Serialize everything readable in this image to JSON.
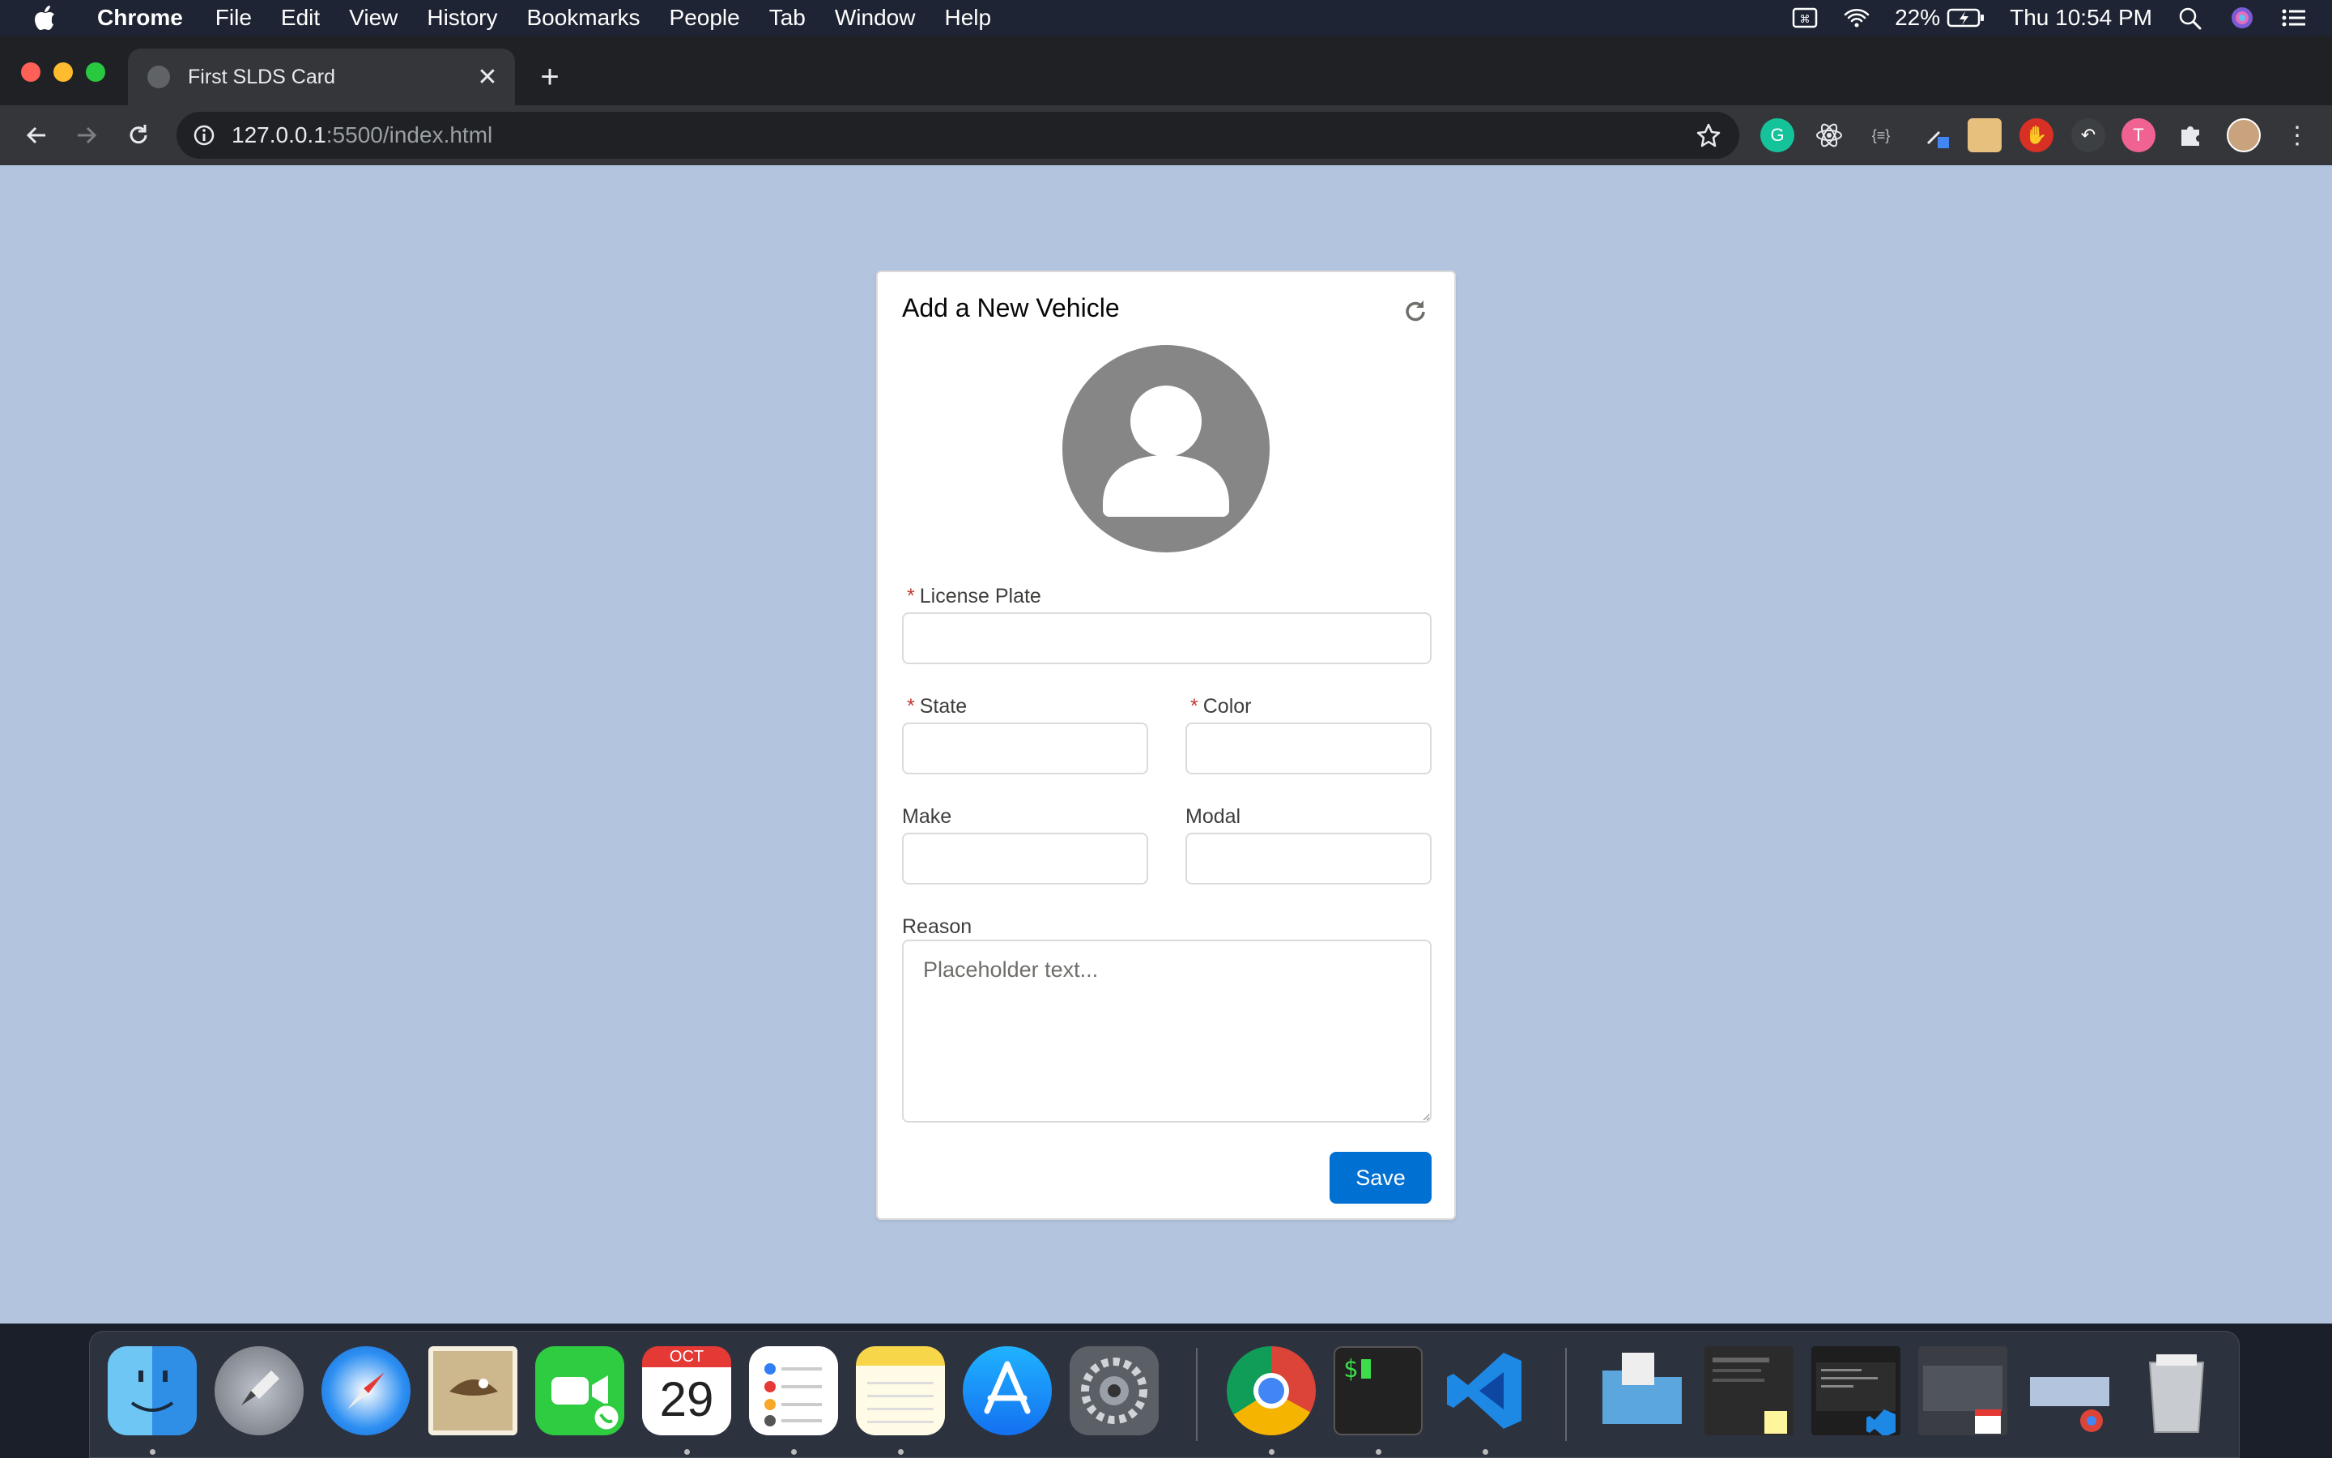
{
  "menubar": {
    "app": "Chrome",
    "items": [
      "File",
      "Edit",
      "View",
      "History",
      "Bookmarks",
      "People",
      "Tab",
      "Window",
      "Help"
    ],
    "battery": "22%",
    "clock": "Thu 10:54 PM"
  },
  "browser": {
    "tab_title": "First SLDS Card",
    "url_host": "127.0.0.1",
    "url_path": ":5500/index.html",
    "tab_close": "✕",
    "new_tab": "+"
  },
  "card": {
    "title": "Add a New Vehicle",
    "required_mark": "*",
    "license_plate_label": "License Plate",
    "state_label": "State",
    "color_label": "Color",
    "make_label": "Make",
    "modal_label": "Modal",
    "reason_label": "Reason",
    "reason_placeholder": "Placeholder text...",
    "save_label": "Save"
  },
  "dock": {
    "calendar_month": "OCT",
    "calendar_day": "29"
  },
  "colors": {
    "page_bg": "#b2c4de",
    "brand_button": "#0070d2",
    "required": "#c23934"
  }
}
